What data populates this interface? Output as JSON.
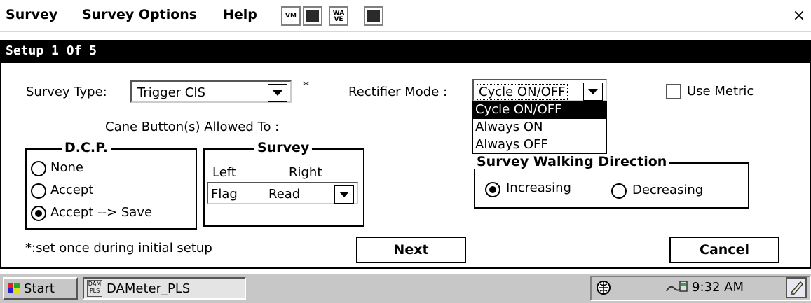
{
  "menubar": {
    "menus": [
      "Survey",
      "Survey Options",
      "Help"
    ],
    "menu_hotkeys": [
      "S",
      "O",
      "H"
    ],
    "vm_label": "VM",
    "wave_label": "WA\nVE",
    "close_label": "×"
  },
  "dialog": {
    "title": "Setup 1 Of 5",
    "survey_type_label": "Survey Type:",
    "survey_type_value": "Trigger CIS",
    "asterisk": "*",
    "rectifier_mode_label": "Rectifier Mode :",
    "rectifier_mode_value": "Cycle ON/OFF",
    "rectifier_options": [
      "Cycle ON/OFF",
      "Always ON",
      "Always OFF"
    ],
    "use_metric_label": "Use Metric",
    "use_metric_checked": false,
    "cane_buttons_label": "Cane Button(s) Allowed To :",
    "dcp": {
      "title": "D.C.P.",
      "options": [
        "None",
        "Accept",
        "Accept --> Save"
      ],
      "selected": "Accept --> Save"
    },
    "survey_group": {
      "title": "Survey",
      "left_label": "Left",
      "right_label": "Right",
      "left_value": "Flag",
      "right_value": "Read"
    },
    "walking_direction": {
      "title": "Survey Walking Direction",
      "options": [
        "Increasing",
        "Decreasing"
      ],
      "selected": "Increasing"
    },
    "footnote": "*:set once during initial setup",
    "next_label": "Next",
    "cancel_label": "Cancel"
  },
  "taskbar": {
    "start_label": "Start",
    "app_label": "DAMeter_PLS",
    "app_icon_text": "DAM\nPLS",
    "clock": "9:32 AM"
  }
}
